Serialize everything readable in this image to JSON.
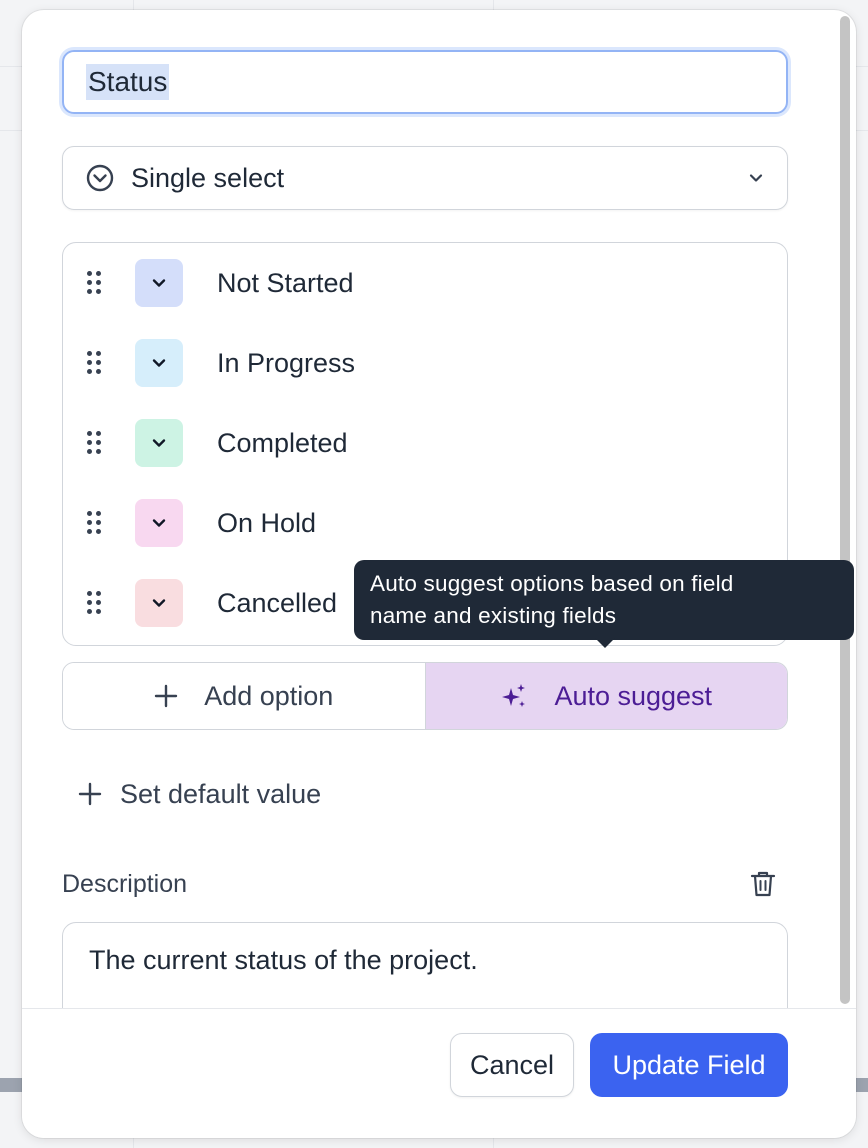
{
  "field": {
    "name_value": "Status",
    "type_label": "Single select",
    "type_icon": "circle-chevron-icon"
  },
  "options": [
    {
      "label": "Not Started",
      "color": "#d4defa"
    },
    {
      "label": "In Progress",
      "color": "#d6eefb"
    },
    {
      "label": "Completed",
      "color": "#cdf3e4"
    },
    {
      "label": "On Hold",
      "color": "#f8d8f0"
    },
    {
      "label": "Cancelled",
      "color": "#f9dde0"
    }
  ],
  "actions": {
    "add_option_label": "Add option",
    "auto_suggest_label": "Auto suggest"
  },
  "tooltip": {
    "line1": "Auto suggest options based on field",
    "line2": "name and existing fields"
  },
  "default_value": {
    "label": "Set default value"
  },
  "description": {
    "label": "Description",
    "value": "The current status of the project."
  },
  "footer": {
    "cancel_label": "Cancel",
    "update_label": "Update Field"
  },
  "colors": {
    "primary": "#3b63f0",
    "auto_suggest_bg": "#e6d5f2",
    "auto_suggest_text": "#4c1d95",
    "tooltip_bg": "#1f2937"
  }
}
